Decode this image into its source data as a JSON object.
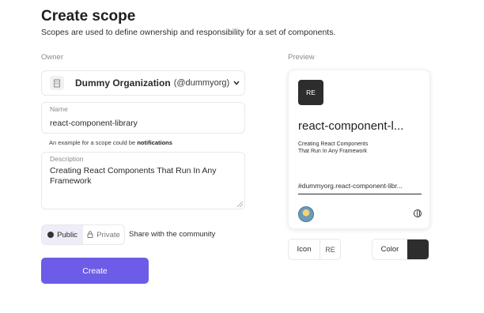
{
  "header": {
    "title": "Create scope",
    "subtitle": "Scopes are used to define ownership and responsibility for a set of components."
  },
  "owner": {
    "label": "Owner",
    "org_name": "Dummy Organization",
    "org_handle": "(@dummyorg)"
  },
  "name_field": {
    "label": "Name",
    "value": "react-component-library",
    "hint_prefix": "An example for a scope could be",
    "hint_example": "notifications"
  },
  "description_field": {
    "label": "Description",
    "value": "Creating React Components That Run In Any Framework"
  },
  "visibility": {
    "public_label": "Public",
    "private_label": "Private",
    "selected": "Public",
    "share_text": "Share with the community"
  },
  "create_button": {
    "label": "Create"
  },
  "preview": {
    "label": "Preview",
    "badge_text": "RE",
    "card_title": "react-component-l...",
    "card_description": "Creating React Components That Run In Any Framework",
    "card_id": "#dummyorg.react-component-libr..."
  },
  "icon_picker": {
    "label": "Icon",
    "value": "RE"
  },
  "color_picker": {
    "label": "Color",
    "value": "#2d2d2d"
  },
  "colors": {
    "accent": "#6c5ce7",
    "badge": "#2d2d2d"
  }
}
